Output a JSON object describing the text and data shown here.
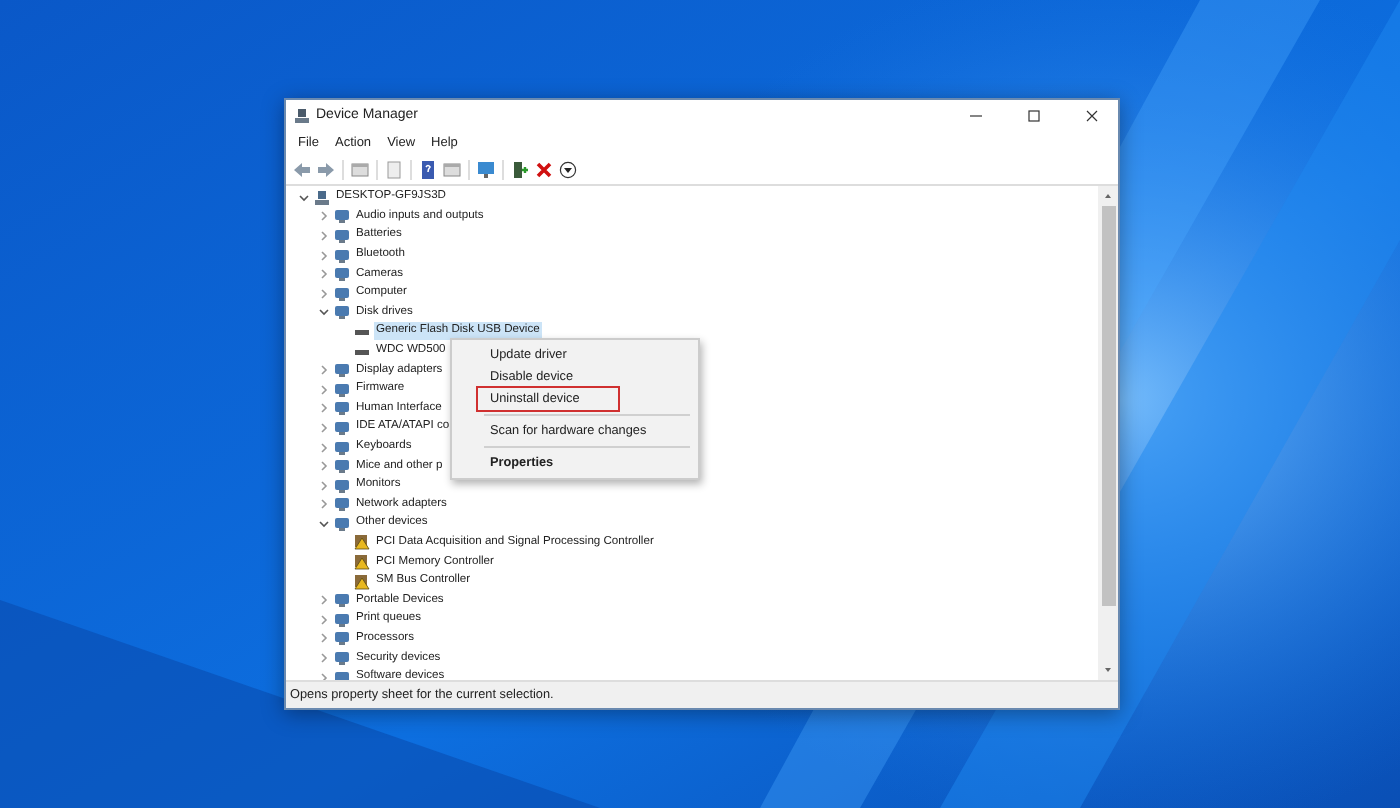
{
  "window": {
    "title": "Device Manager"
  },
  "menu_bar": [
    "File",
    "Action",
    "View",
    "Help"
  ],
  "tree": [
    {
      "label": "DESKTOP-GF9JS3D",
      "expanded": true,
      "selected": false,
      "children": [
        {
          "label": "Audio inputs and outputs",
          "expanded": false,
          "selected": false
        },
        {
          "label": "Batteries",
          "expanded": false,
          "selected": false
        },
        {
          "label": "Bluetooth",
          "expanded": false,
          "selected": false
        },
        {
          "label": "Cameras",
          "expanded": false,
          "selected": false
        },
        {
          "label": "Computer",
          "expanded": false,
          "selected": false
        },
        {
          "label": "Disk drives",
          "expanded": true,
          "selected": false,
          "children": [
            {
              "label": "Generic Flash Disk USB Device",
              "selected": true,
              "warning": false
            },
            {
              "label": "WDC WD500",
              "selected": false,
              "warning": false
            }
          ]
        },
        {
          "label": "Display adapters",
          "expanded": false,
          "selected": false
        },
        {
          "label": "Firmware",
          "expanded": false,
          "selected": false
        },
        {
          "label": "Human Interface",
          "expanded": false,
          "selected": false
        },
        {
          "label": "IDE ATA/ATAPI co",
          "expanded": false,
          "selected": false
        },
        {
          "label": "Keyboards",
          "expanded": false,
          "selected": false
        },
        {
          "label": "Mice and other p",
          "expanded": false,
          "selected": false
        },
        {
          "label": "Monitors",
          "expanded": false,
          "selected": false
        },
        {
          "label": "Network adapters",
          "expanded": false,
          "selected": false
        },
        {
          "label": "Other devices",
          "expanded": true,
          "selected": false,
          "children": [
            {
              "label": "PCI Data Acquisition and Signal Processing Controller",
              "selected": false,
              "warning": true
            },
            {
              "label": "PCI Memory Controller",
              "selected": false,
              "warning": true
            },
            {
              "label": "SM Bus Controller",
              "selected": false,
              "warning": true
            }
          ]
        },
        {
          "label": "Portable Devices",
          "expanded": false,
          "selected": false
        },
        {
          "label": "Print queues",
          "expanded": false,
          "selected": false
        },
        {
          "label": "Processors",
          "expanded": false,
          "selected": false
        },
        {
          "label": "Security devices",
          "expanded": false,
          "selected": false
        },
        {
          "label": "Software devices",
          "expanded": false,
          "selected": false
        }
      ]
    }
  ],
  "context_menu": [
    {
      "kind": "item",
      "label": "Update driver",
      "highlighted": false
    },
    {
      "kind": "item",
      "label": "Disable device",
      "highlighted": false
    },
    {
      "kind": "item",
      "label": "Uninstall device",
      "highlighted": true
    },
    {
      "kind": "separator"
    },
    {
      "kind": "item",
      "label": "Scan for hardware changes",
      "highlighted": false
    },
    {
      "kind": "separator"
    },
    {
      "kind": "default",
      "label": "Properties",
      "highlighted": false
    }
  ],
  "status_bar": "Opens property sheet for the current selection."
}
